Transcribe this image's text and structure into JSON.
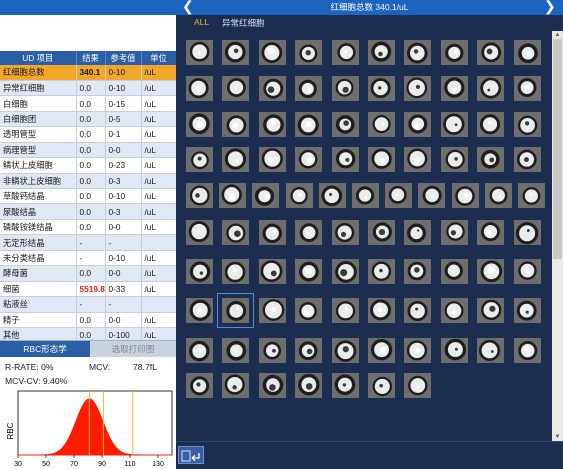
{
  "header": {
    "title": "红细胞总数 340.1/uL",
    "prev_icon": "chevron-left-icon",
    "next_icon": "chevron-right-icon"
  },
  "subtabs": [
    "ALL",
    "异常红细胞"
  ],
  "table": {
    "headers": [
      "UD 项目",
      "结果",
      "参考值",
      "单位"
    ],
    "rows": [
      [
        "红细胞总数",
        "340.1",
        "0-10",
        "/uL"
      ],
      [
        "异常红细胞",
        "0.0",
        "0-10",
        "/uL"
      ],
      [
        "白细胞",
        "0.0",
        "0-15",
        "/uL"
      ],
      [
        "白细胞团",
        "0.0",
        "0-5",
        "/uL"
      ],
      [
        "透明管型",
        "0.0",
        "0-1",
        "/uL"
      ],
      [
        "病理管型",
        "0.0",
        "0-0",
        "/uL"
      ],
      [
        "鳞状上皮细胞",
        "0.0",
        "0-23",
        "/uL"
      ],
      [
        "非鳞状上皮细胞",
        "0.0",
        "0-3",
        "/uL"
      ],
      [
        "草酸钙结晶",
        "0.0",
        "0-10",
        "/uL"
      ],
      [
        "尿酸结晶",
        "0.0",
        "0-3",
        "/uL"
      ],
      [
        "磷酸铵镁结晶",
        "0.0",
        "0-0",
        "/uL"
      ],
      [
        "无定形结晶",
        "-",
        "-",
        ""
      ],
      [
        "未分类结晶",
        "-",
        "0-10",
        "/uL"
      ],
      [
        "酵母菌",
        "0.0",
        "0-0",
        "/uL"
      ],
      [
        "细菌",
        "5519.8",
        "0-33",
        "/uL"
      ],
      [
        "粘液丝",
        "-",
        "-",
        ""
      ],
      [
        "精子",
        "0.0",
        "0-0",
        "/uL"
      ],
      [
        "其他",
        "0.0",
        "0-100",
        "/uL"
      ]
    ],
    "selected_row": 0,
    "highlight_rows": [
      0,
      14
    ]
  },
  "rbc": {
    "tab_active": "RBC形态学",
    "tab_inactive": "选取打印图",
    "rrate": "R-RATE:   0%",
    "mcv": "MCV:",
    "mcv_value": "78.7fL",
    "mcvcv": "MCV-CV:  9.40%",
    "ylabel": "RBC",
    "xticks": [
      "30",
      "50",
      "70",
      "90",
      "110",
      "130"
    ],
    "xrange": [
      30,
      140
    ],
    "peak": 81,
    "markers": [
      81,
      91,
      112
    ],
    "curve_color": "#ff1a00"
  },
  "cell_rows": [
    10,
    10,
    10,
    10,
    11,
    10,
    10,
    10,
    10,
    7
  ],
  "selected_cell": {
    "row": 7,
    "col": 1
  },
  "colors": {
    "header_blue": "#1d63c0",
    "panel_navy": "#1c2d50",
    "selected_row": "#f2a72b",
    "high_value": "#e0201c"
  }
}
